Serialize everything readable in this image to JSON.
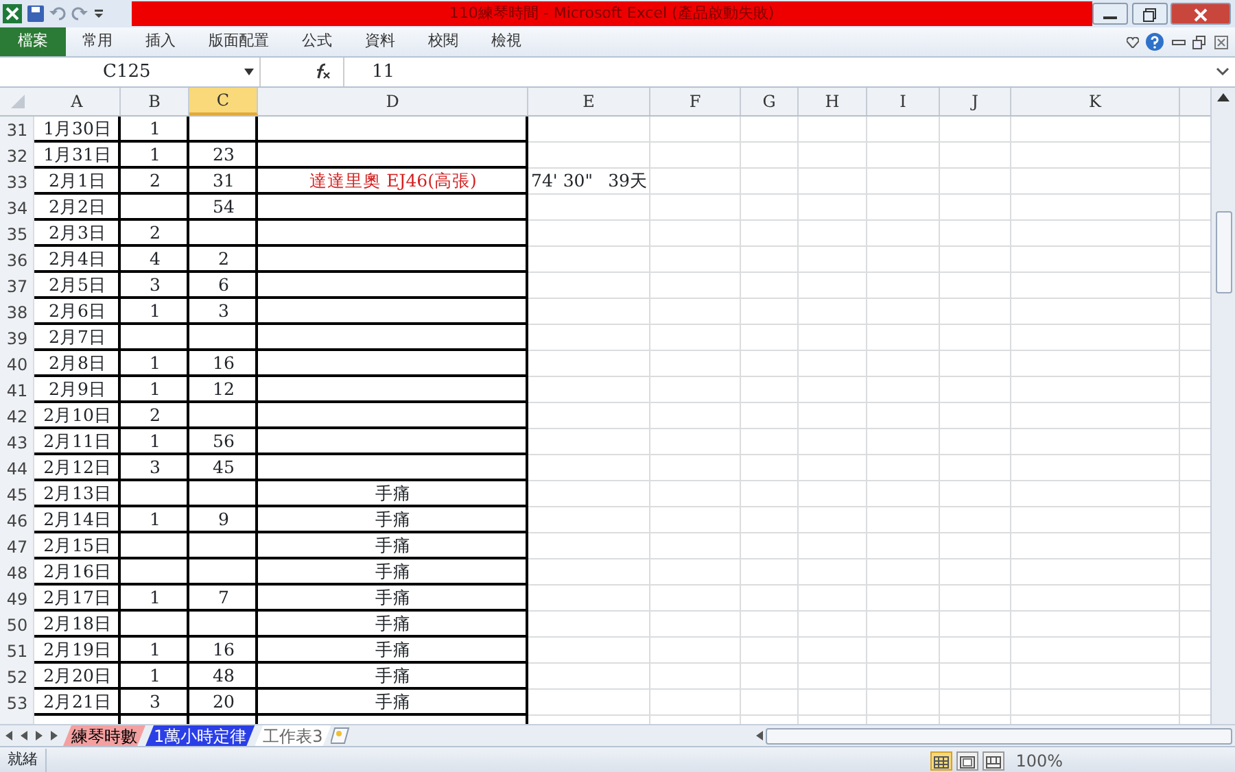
{
  "window": {
    "title": "110練琴時間 - Microsoft Excel (產品啟動失敗)"
  },
  "ribbon_tabs": [
    {
      "label": "檔案",
      "kind": "file"
    },
    {
      "label": "常用",
      "kind": "tab"
    },
    {
      "label": "插入",
      "kind": "tab"
    },
    {
      "label": "版面配置",
      "kind": "tab"
    },
    {
      "label": "公式",
      "kind": "tab"
    },
    {
      "label": "資料",
      "kind": "tab"
    },
    {
      "label": "校閱",
      "kind": "tab"
    },
    {
      "label": "檢視",
      "kind": "tab"
    }
  ],
  "formula_bar": {
    "name_box": "C125",
    "formula": "11"
  },
  "columns": [
    {
      "label": "A",
      "selected": false
    },
    {
      "label": "B",
      "selected": false
    },
    {
      "label": "C",
      "selected": true
    },
    {
      "label": "D",
      "selected": false
    },
    {
      "label": "E",
      "selected": false
    },
    {
      "label": "F",
      "selected": false
    },
    {
      "label": "G",
      "selected": false
    },
    {
      "label": "H",
      "selected": false
    },
    {
      "label": "I",
      "selected": false
    },
    {
      "label": "J",
      "selected": false
    },
    {
      "label": "K",
      "selected": false
    }
  ],
  "rows": [
    {
      "row": "31",
      "a": "1月30日",
      "b": "1"
    },
    {
      "row": "32",
      "a": "1月31日",
      "b": "1",
      "c": "23"
    },
    {
      "row": "33",
      "a": "2月1日",
      "b": "2",
      "c": "31",
      "d": "達達里奧 EJ46(高張)",
      "color": "#d42020",
      "e": "74' 30\"",
      "e_right": "39天"
    },
    {
      "row": "34",
      "a": "2月2日",
      "c": "54"
    },
    {
      "row": "35",
      "a": "2月3日",
      "b": "2"
    },
    {
      "row": "36",
      "a": "2月4日",
      "b": "4",
      "c": "2"
    },
    {
      "row": "37",
      "a": "2月5日",
      "b": "3",
      "c": "6"
    },
    {
      "row": "38",
      "a": "2月6日",
      "b": "1",
      "c": "3"
    },
    {
      "row": "39",
      "a": "2月7日"
    },
    {
      "row": "40",
      "a": "2月8日",
      "b": "1",
      "c": "16"
    },
    {
      "row": "41",
      "a": "2月9日",
      "b": "1",
      "c": "12"
    },
    {
      "row": "42",
      "a": "2月10日",
      "b": "2"
    },
    {
      "row": "43",
      "a": "2月11日",
      "b": "1",
      "c": "56"
    },
    {
      "row": "44",
      "a": "2月12日",
      "b": "3",
      "c": "45"
    },
    {
      "row": "45",
      "a": "2月13日",
      "d": "手痛"
    },
    {
      "row": "46",
      "a": "2月14日",
      "b": "1",
      "c": "9",
      "d": "手痛"
    },
    {
      "row": "47",
      "a": "2月15日",
      "d": "手痛"
    },
    {
      "row": "48",
      "a": "2月16日",
      "d": "手痛"
    },
    {
      "row": "49",
      "a": "2月17日",
      "b": "1",
      "c": "7",
      "d": "手痛"
    },
    {
      "row": "50",
      "a": "2月18日",
      "d": "手痛"
    },
    {
      "row": "51",
      "a": "2月19日",
      "b": "1",
      "c": "16",
      "d": "手痛"
    },
    {
      "row": "52",
      "a": "2月20日",
      "b": "1",
      "c": "48",
      "d": "手痛"
    },
    {
      "row": "53",
      "a": "2月21日",
      "b": "3",
      "c": "20",
      "d": "手痛"
    }
  ],
  "sheet_tabs": [
    {
      "label": "練琴時數",
      "selected": true,
      "color": "#f4a0a0"
    },
    {
      "label": "1萬小時定律",
      "selected": false,
      "color": "#2a3ee8"
    },
    {
      "label": "工作表3",
      "selected": false
    }
  ],
  "status_bar": {
    "text": "就緒",
    "zoom": "100%",
    "views": [
      {
        "kind": "normal",
        "selected": true
      },
      {
        "kind": "layout",
        "selected": false
      },
      {
        "kind": "pagebreak",
        "selected": false
      }
    ]
  }
}
